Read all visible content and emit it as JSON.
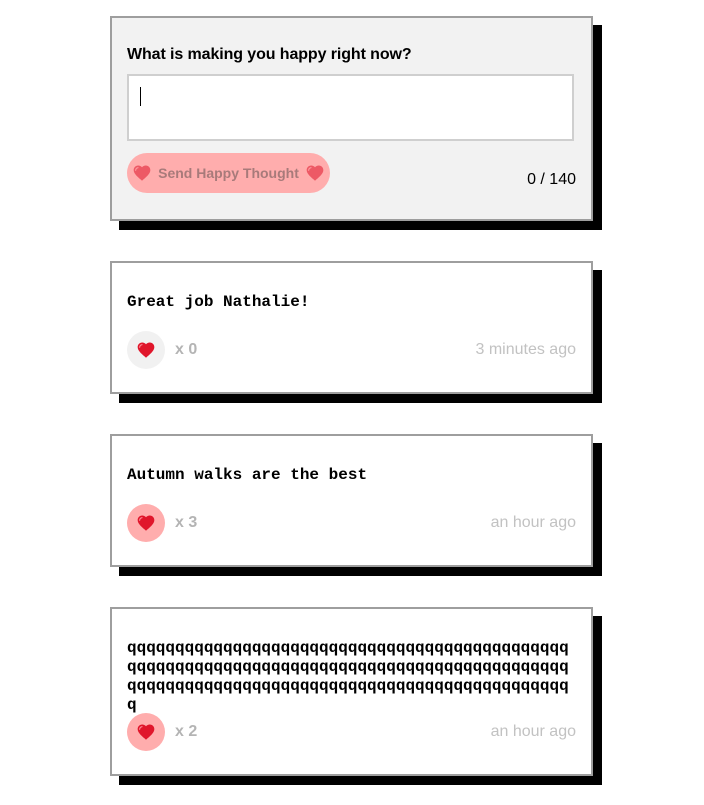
{
  "form": {
    "question": "What is making you happy right now?",
    "input_value": "",
    "send_label": "Send Happy Thought",
    "counter": "0 / 140"
  },
  "thoughts": [
    {
      "message": "Great job Nathalie!",
      "likes": "x 0",
      "time": "3 minutes ago"
    },
    {
      "message": "Autumn walks are the best",
      "likes": "x 3",
      "time": "an hour ago"
    },
    {
      "message": "qqqqqqqqqqqqqqqqqqqqqqqqqqqqqqqqqqqqqqqqqqqqqqqqqqqqqqqqqqqqqqqqqqqqqqqqqqqqqqqqqqqqqqqqqqqqqqqqqqqqqqqqqqqqqqqqqqqqqqqqqqqqqqqqqqqqqqqqqqq",
      "likes": "x 2",
      "time": "an hour ago"
    }
  ],
  "colors": {
    "button_pink": "#ffadad",
    "heart_red": "#e0162b",
    "shadow": "#000000"
  },
  "icons": {
    "heart": "heart-icon"
  }
}
